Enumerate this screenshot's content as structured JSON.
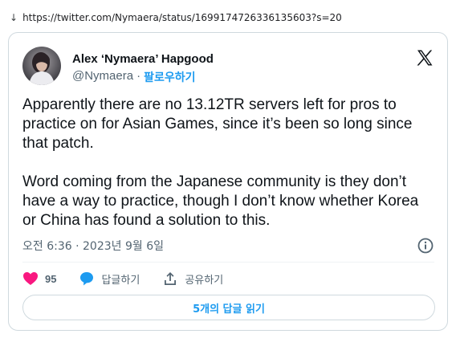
{
  "browser": {
    "url": "https://twitter.com/Nymaera/status/1699174726336135603?s=20",
    "arrow_glyph": "↓"
  },
  "tweet": {
    "author_name": "Alex ‘Nymaera’ Hapgood",
    "handle": "@Nymaera",
    "separator": "·",
    "follow_label": "팔로우하기",
    "paragraphs": [
      "Apparently there are no 13.12TR servers left for pros to practice on for Asian Games, since it’s been so long since that patch.",
      "Word coming from the Japanese community is they don’t have a way to practice, though I don’t know whether Korea or China has found a solution to this."
    ],
    "timestamp": "오전 6:36 · 2023년 9월 6일",
    "actions": {
      "like_count": "95",
      "reply_label": "답글하기",
      "share_label": "공유하기"
    },
    "read_replies_label": "5개의 답글 읽기"
  },
  "colors": {
    "accent": "#1d9bf0",
    "like": "#f91880",
    "text": "#0f1419",
    "muted": "#536471",
    "border": "#cfd9de"
  },
  "icons": [
    "download-arrow-icon",
    "avatar",
    "x-logo-icon",
    "info-icon",
    "heart-icon",
    "reply-bubble-icon",
    "share-icon"
  ]
}
